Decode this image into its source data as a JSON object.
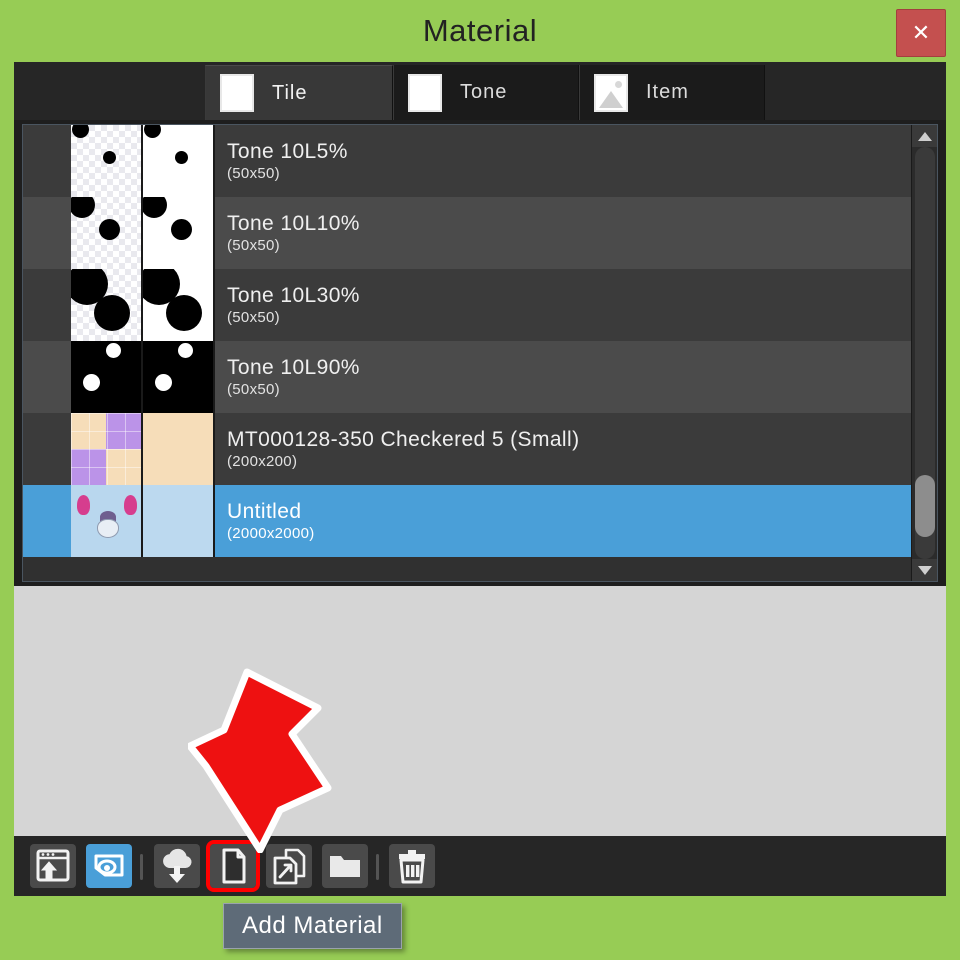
{
  "window": {
    "title": "Material",
    "close_label": "✕",
    "close_icon": "close-icon",
    "accent_green": "#97cc55",
    "close_red": "#c4504f",
    "selection_blue": "#4a9fd8",
    "highlight_red": "#ff0000"
  },
  "tabs": [
    {
      "label": "Tile",
      "icon": "checkerboard-icon",
      "active": true
    },
    {
      "label": "Tone",
      "icon": "halftone-dots-icon",
      "active": false
    },
    {
      "label": "Item",
      "icon": "picture-icon",
      "active": false
    }
  ],
  "list": {
    "items": [
      {
        "name": "Tone 10L5%",
        "size": "(50x50)",
        "selected": false
      },
      {
        "name": "Tone 10L10%",
        "size": "(50x50)",
        "selected": false
      },
      {
        "name": "Tone 10L30%",
        "size": "(50x50)",
        "selected": false
      },
      {
        "name": "Tone 10L90%",
        "size": "(50x50)",
        "selected": false
      },
      {
        "name": "MT000128-350 Checkered 5 (Small)",
        "size": "(200x200)",
        "selected": false
      },
      {
        "name": "Untitled",
        "size": "(2000x2000)",
        "selected": true
      }
    ]
  },
  "scrollbar": {
    "up_icon": "chevron-up-icon",
    "down_icon": "chevron-down-icon",
    "thumb_name": "scrollbar-thumb"
  },
  "toolbar": {
    "buttons": [
      {
        "name": "paste-to-canvas-button",
        "icon": "window-arrow-up-icon",
        "state": "normal"
      },
      {
        "name": "show-preview-button",
        "icon": "preview-eye-icon",
        "state": "active"
      },
      {
        "name": "download-material-button",
        "icon": "cloud-download-icon",
        "state": "normal"
      },
      {
        "name": "add-material-button",
        "icon": "new-document-icon",
        "state": "highlighted"
      },
      {
        "name": "duplicate-material-button",
        "icon": "document-share-icon",
        "state": "normal"
      },
      {
        "name": "new-folder-button",
        "icon": "folder-icon",
        "state": "normal"
      },
      {
        "name": "delete-material-button",
        "icon": "trash-icon",
        "state": "normal"
      }
    ]
  },
  "tooltip": {
    "text": "Add Material"
  },
  "annotation": {
    "arrow_icon": "red-arrow-pointing-down-right",
    "arrow_color": "#ee1111"
  }
}
